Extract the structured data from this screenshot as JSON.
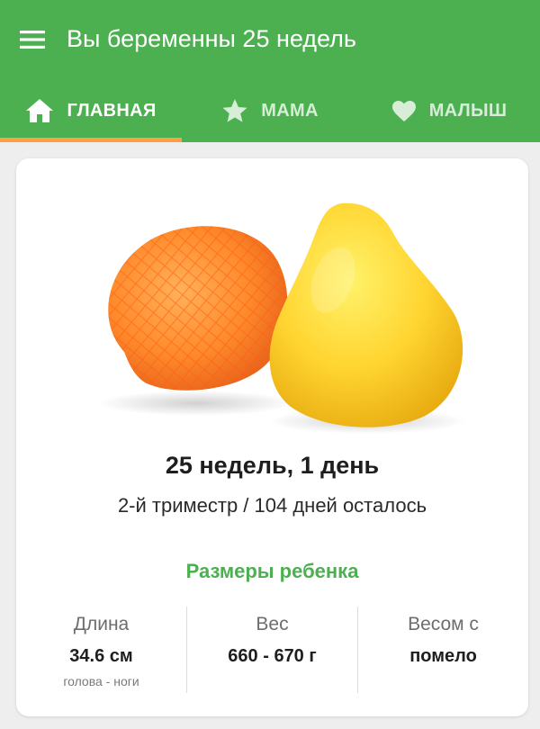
{
  "header": {
    "title": "Вы беременны 25 недель",
    "menu_icon": "hamburger-menu-icon"
  },
  "tabs": [
    {
      "label": "ГЛАВНАЯ",
      "icon": "home-icon",
      "active": true
    },
    {
      "label": "МАМА",
      "icon": "star-icon",
      "active": false
    },
    {
      "label": "МАЛЫШ",
      "icon": "heart-icon",
      "active": false
    }
  ],
  "colors": {
    "primary": "#4caf50",
    "tab_indicator": "#ff9f43",
    "accent_text": "#4caf50"
  },
  "card": {
    "image": "pomelo-fruit",
    "week_day": "25 недель, 1 день",
    "trimester_info": "2-й триместр / 104 дней осталось",
    "section_title": "Размеры ребенка",
    "stats": [
      {
        "label": "Длина",
        "value": "34.6 см",
        "sub": "голова - ноги"
      },
      {
        "label": "Вес",
        "value": "660 - 670 г",
        "sub": ""
      },
      {
        "label": "Весом с",
        "value": "помело",
        "sub": ""
      }
    ]
  }
}
